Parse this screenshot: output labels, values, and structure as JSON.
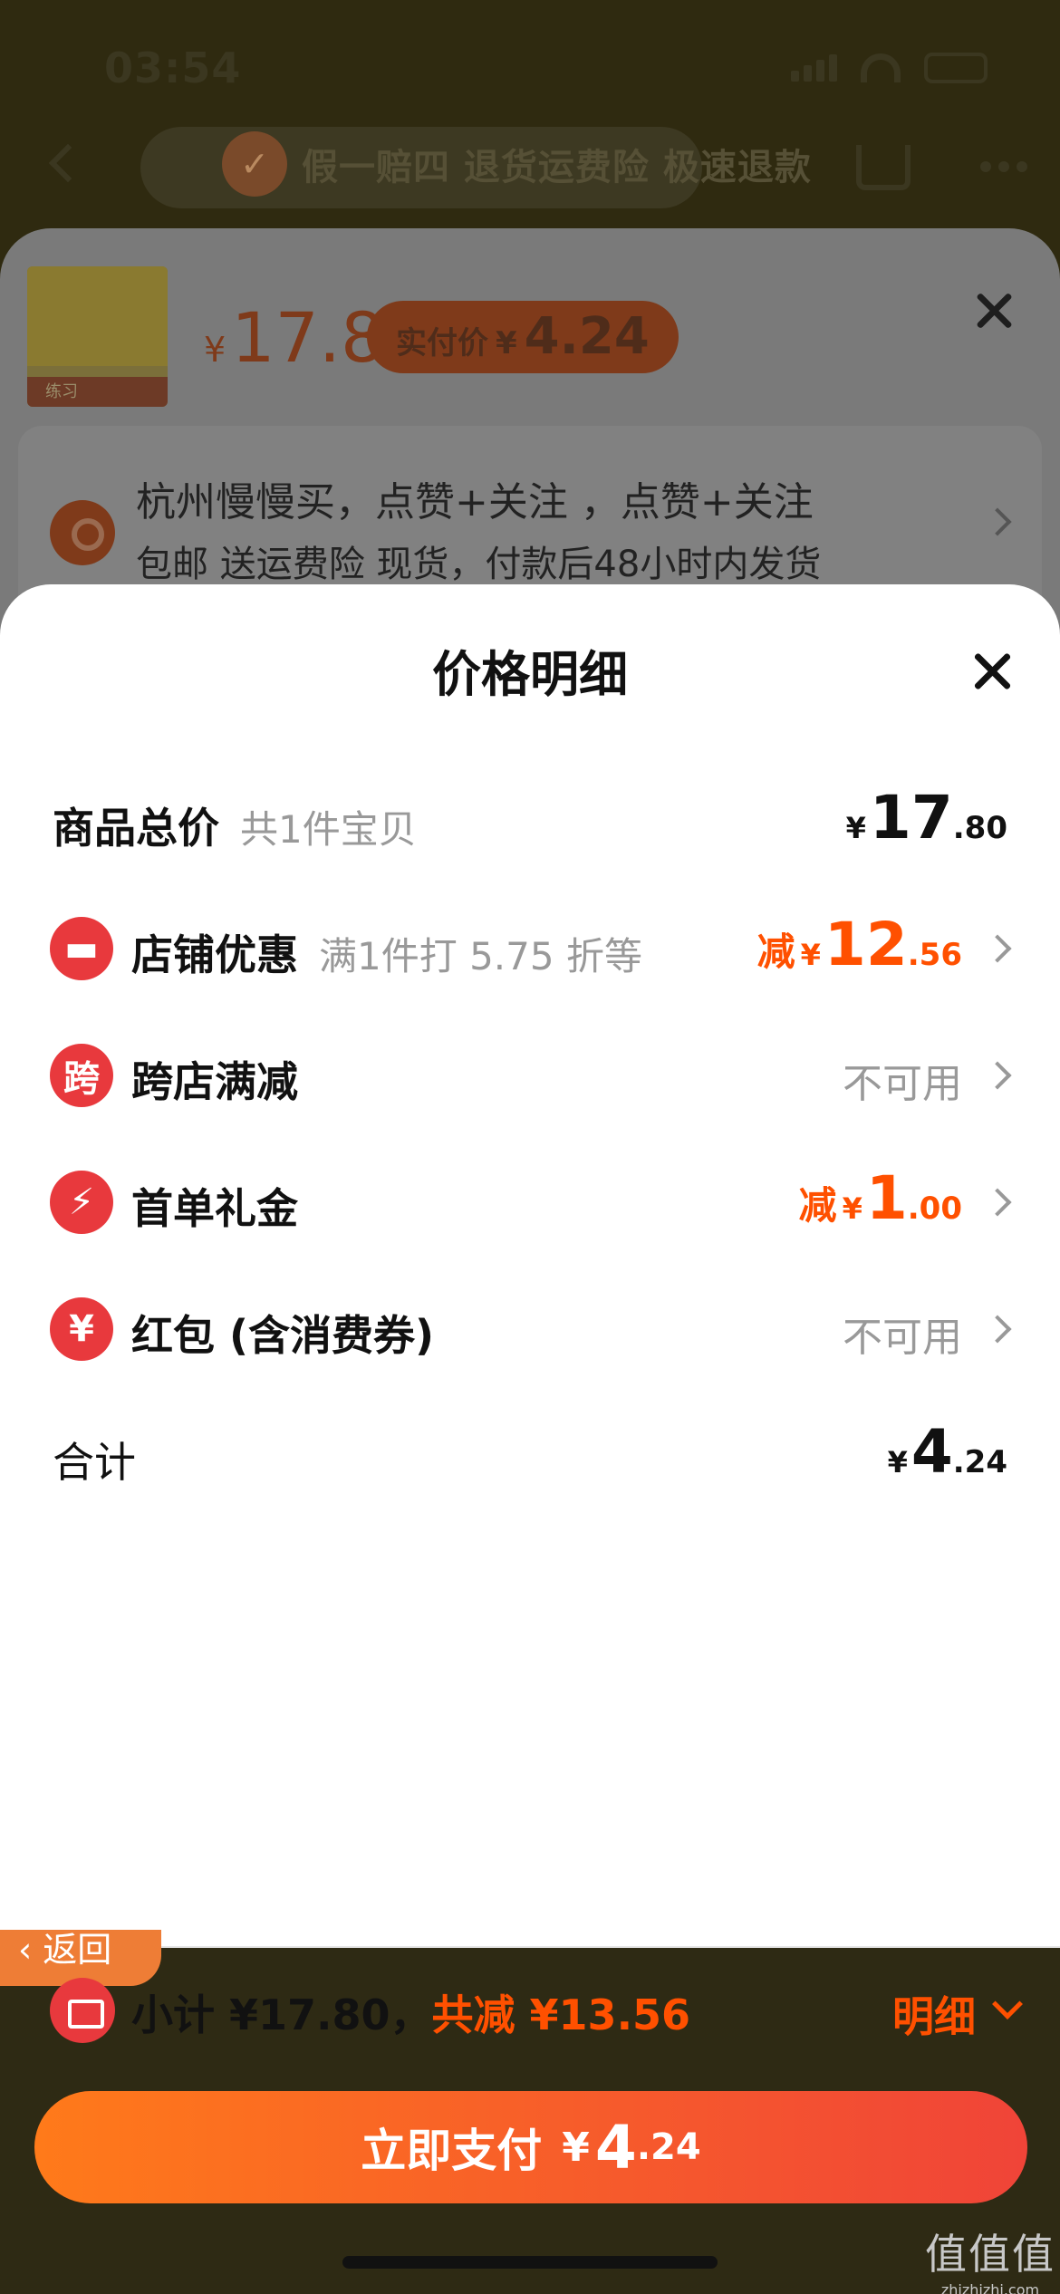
{
  "status_bar": {
    "time": "03:54"
  },
  "header": {
    "promo_banner": "假一赔四 退货运费险 极速退款"
  },
  "product": {
    "currency": "¥",
    "price": "17.8",
    "actual_label": "实付价",
    "actual_price": "4.24",
    "thumbnail_text": "练习"
  },
  "address": {
    "line1": "杭州慢慢买，点赞+关注 ，点赞+关注",
    "line2": "包邮  送运费险  现货，付款后48小时内发货"
  },
  "price_detail": {
    "title": "价格明细",
    "rows": [
      {
        "label": "商品总价",
        "sub": "共1件宝贝",
        "currency": "¥",
        "value_int": "17",
        "value_dec": ".80"
      },
      {
        "label": "店铺优惠",
        "sub": "满1件打 5.75 折等",
        "prefix": "减",
        "currency": "¥",
        "value_int": "12",
        "value_dec": ".56",
        "icon_text": ""
      },
      {
        "label": "跨店满减",
        "status": "不可用",
        "icon_text": "跨"
      },
      {
        "label": "首单礼金",
        "prefix": "减",
        "currency": "¥",
        "value_int": "1",
        "value_dec": ".00"
      },
      {
        "label": "红包 (含消费券)",
        "status": "不可用",
        "icon_text": "¥"
      },
      {
        "label": "合计",
        "currency": "¥",
        "value_int": "4",
        "value_dec": ".24"
      }
    ]
  },
  "bottom_bar": {
    "back_label": "返回",
    "subtotal_text": "小计 ¥17.80，",
    "discount_text": "共减 ¥13.56",
    "detail_label": "明细",
    "pay_label": "立即支付",
    "pay_currency": "¥",
    "pay_int": "4",
    "pay_dec": ".24"
  },
  "watermark": {
    "main": "值值值",
    "sub": "zhizhizhi.com"
  },
  "colors": {
    "accent_orange": "#ff5000",
    "accent_red": "#e8393d",
    "pay_gradient_start": "#ff7a1a",
    "pay_gradient_end": "#f04438"
  }
}
